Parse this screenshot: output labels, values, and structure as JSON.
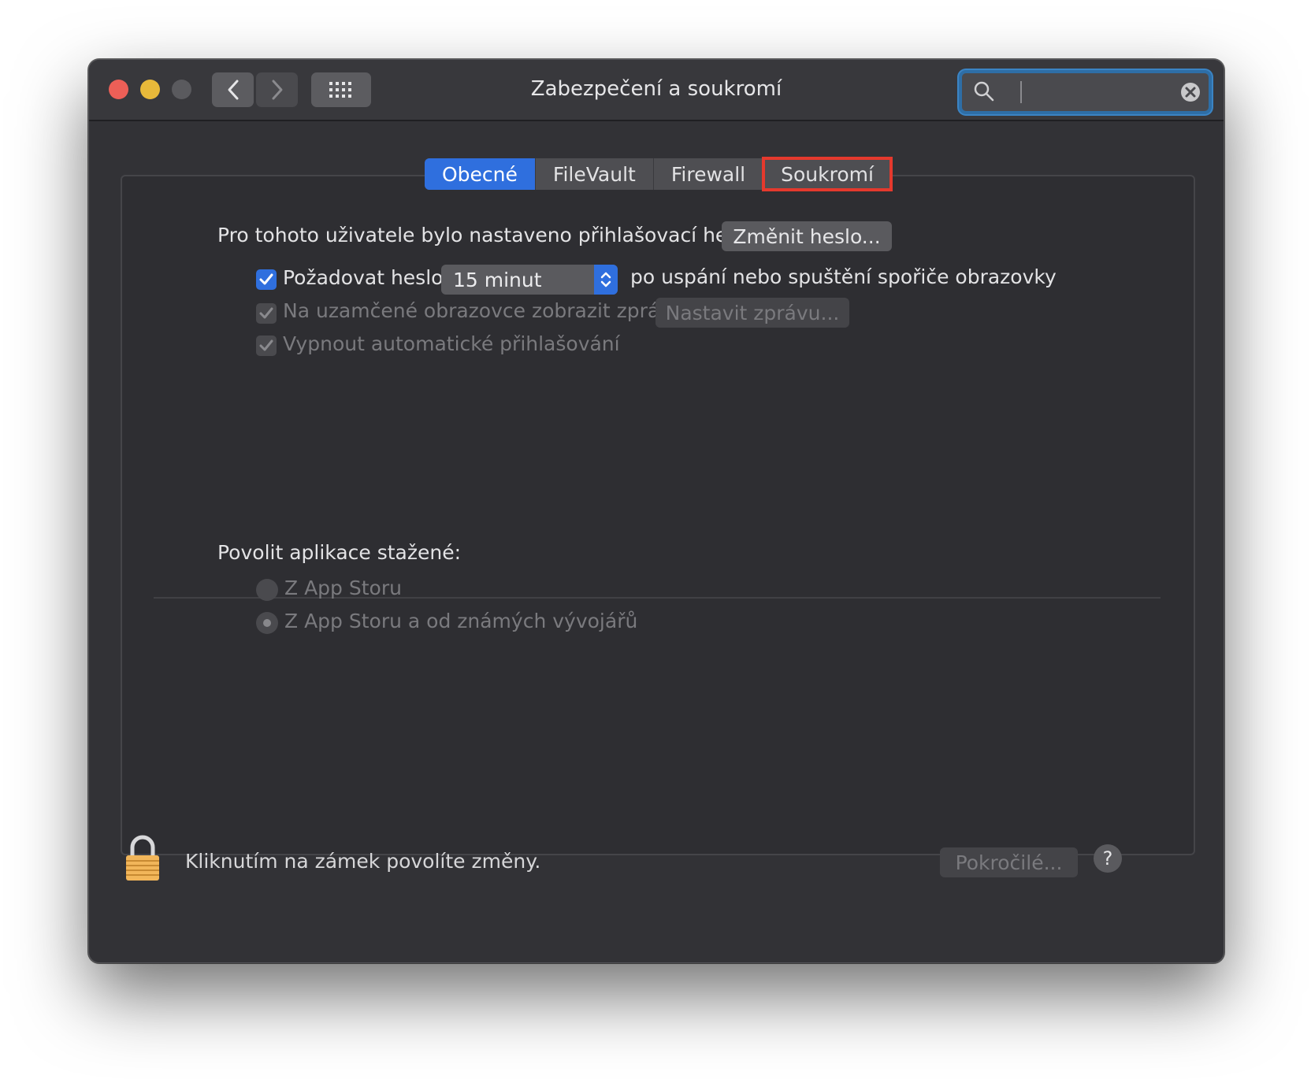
{
  "window": {
    "title": "Zabezpečení a soukromí",
    "search": {
      "placeholder": "",
      "value": ""
    }
  },
  "tabs": [
    {
      "label": "Obecné",
      "active": true
    },
    {
      "label": "FileVault",
      "active": false
    },
    {
      "label": "Firewall",
      "active": false
    },
    {
      "label": "Soukromí",
      "active": false,
      "highlighted": true
    }
  ],
  "general": {
    "password_set_text": "Pro tohoto uživatele bylo nastaveno přihlašovací heslo",
    "change_password_button": "Změnit heslo...",
    "require_password": {
      "label": "Požadovat heslo",
      "checked": true,
      "delay": "15 minut",
      "suffix": "po uspání nebo spuštění spořiče obrazovky"
    },
    "show_message": {
      "label": "Na uzamčené obrazovce zobrazit zprávu",
      "checked": true,
      "enabled": false,
      "button": "Nastavit zprávu..."
    },
    "disable_autologin": {
      "label": "Vypnout automatické přihlašování",
      "checked": true,
      "enabled": false
    }
  },
  "downloads": {
    "heading": "Povolit aplikace stažené:",
    "options": [
      {
        "label": "Z App Storu",
        "selected": false
      },
      {
        "label": "Z App Storu a od známých vývojářů",
        "selected": true
      }
    ]
  },
  "footer": {
    "lock_text": "Kliknutím na zámek povolíte změny.",
    "advanced_button": "Pokročilé...",
    "help_label": "?"
  },
  "colors": {
    "accent": "#2f6fde",
    "highlight_outline": "#e5392d",
    "window_bg": "#323236"
  }
}
